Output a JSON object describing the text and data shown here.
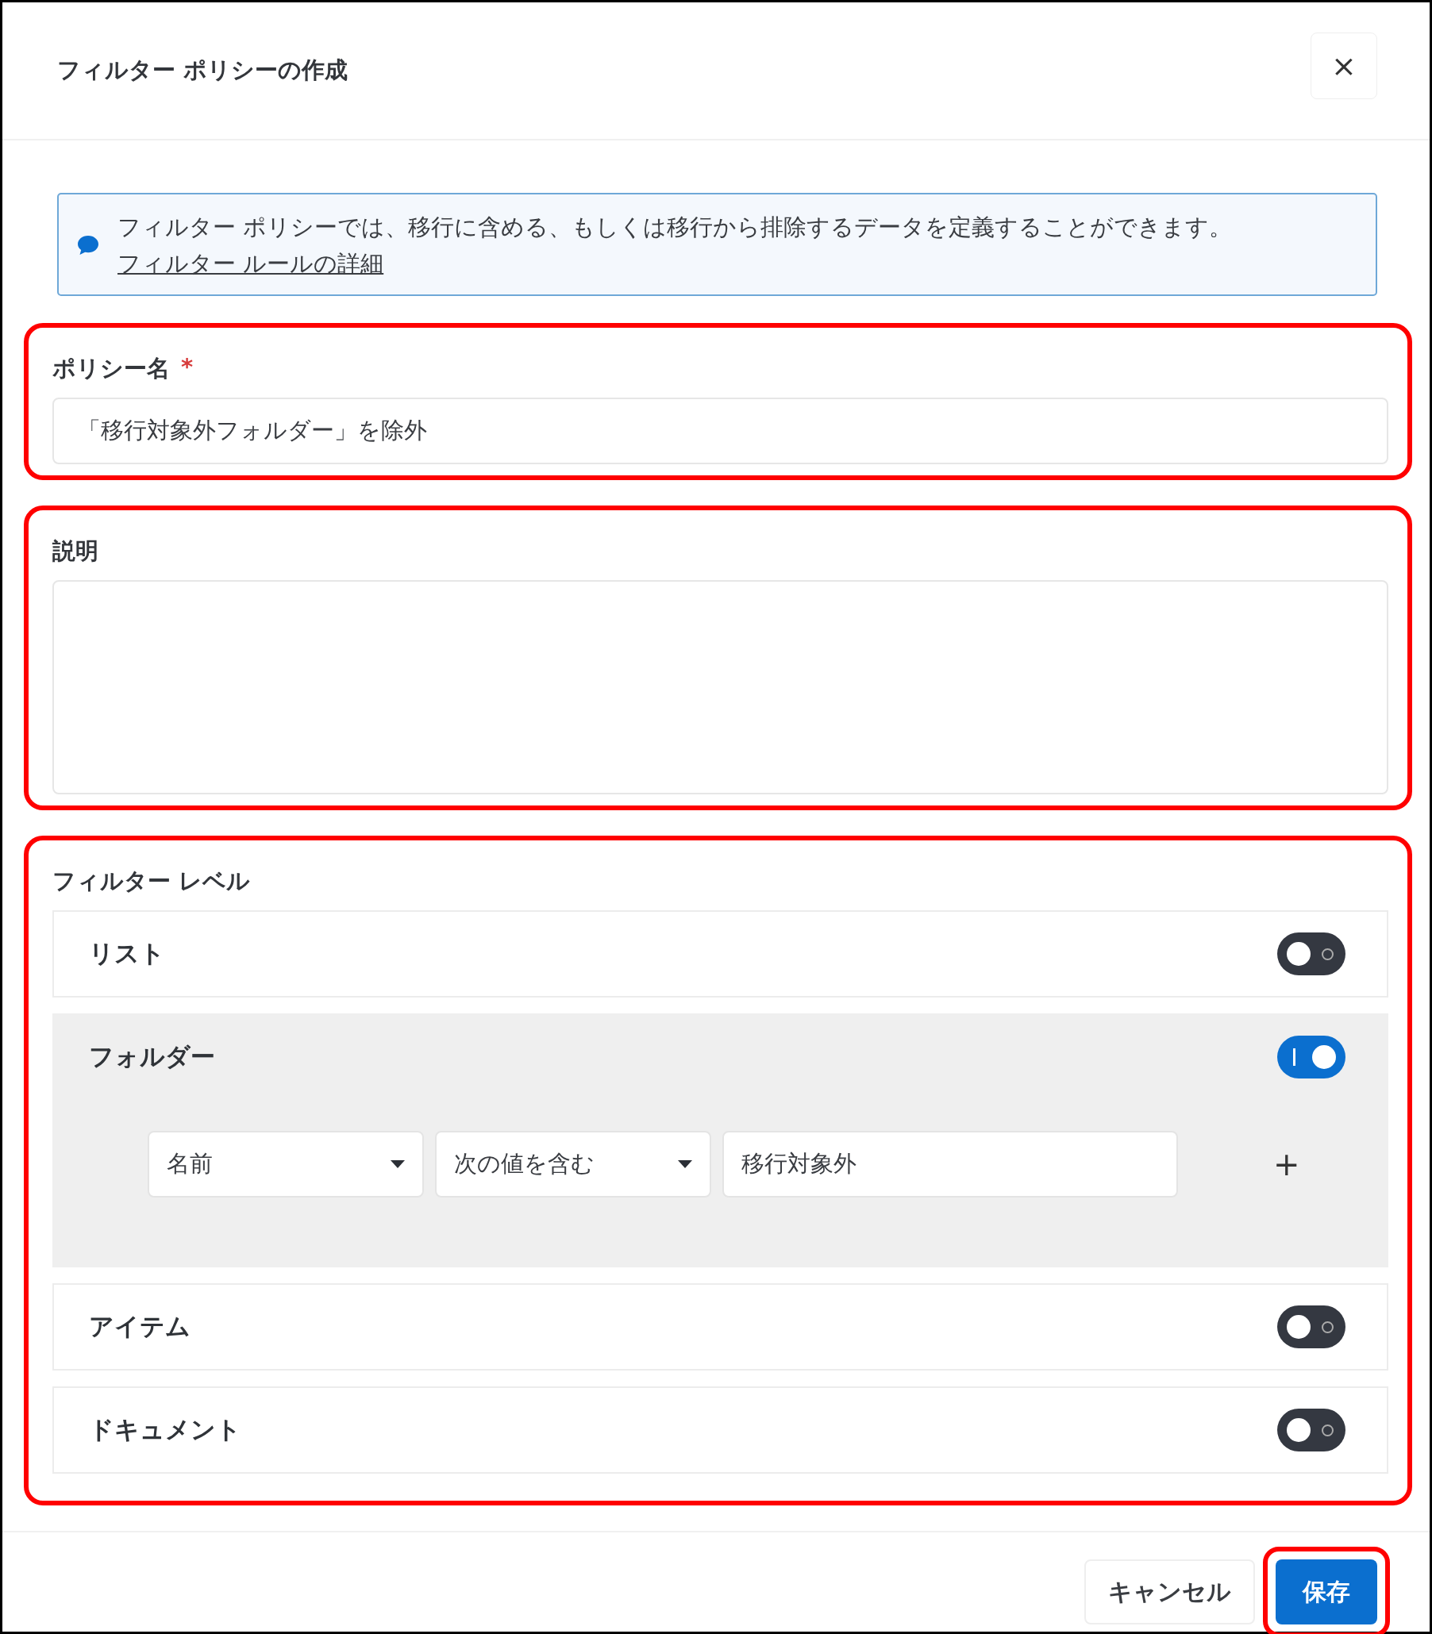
{
  "dialog": {
    "title": "フィルター ポリシーの作成",
    "close_label": "×"
  },
  "info": {
    "text": "フィルター ポリシーでは、移行に含める、もしくは移行から排除するデータを定義することができます。",
    "link": "フィルター ルールの詳細"
  },
  "policy_name": {
    "label": "ポリシー名",
    "required_mark": "*",
    "value": "「移行対象外フォルダー」を除外",
    "highlighted": true
  },
  "description": {
    "label": "説明",
    "highlighted": true
  },
  "filter_level": {
    "label": "フィルター レベル",
    "highlighted": true,
    "levels": [
      {
        "label": "リスト",
        "on": false
      },
      {
        "label": "フォルダー",
        "on": true,
        "rules": [
          {
            "field": "名前",
            "operator": "次の値を含む",
            "value": "移行対象外",
            "add_label": "+"
          }
        ]
      },
      {
        "label": "アイテム",
        "on": false
      },
      {
        "label": "ドキュメント",
        "on": false
      }
    ]
  },
  "buttons": [
    {
      "label": "キャンセル",
      "kind": "secondary",
      "highlighted": false
    },
    {
      "label": "保存",
      "kind": "primary",
      "highlighted": true
    }
  ]
}
